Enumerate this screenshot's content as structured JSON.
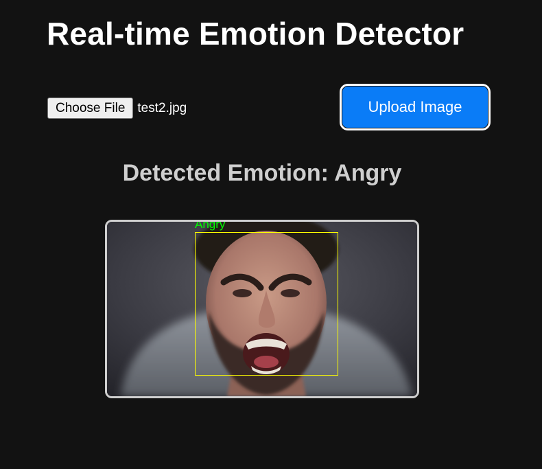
{
  "app": {
    "title": "Real-time Emotion Detector"
  },
  "upload": {
    "choose_file_label": "Choose File",
    "selected_file": "test2.jpg",
    "upload_button_label": "Upload Image"
  },
  "result": {
    "heading": "Detected Emotion: Angry",
    "face_label": "Angry",
    "box_color": "#ffff00",
    "label_color": "#00ff00",
    "image_alt": "Photo of a shouting bearded man with detected face bounding box"
  },
  "colors": {
    "background": "#121212",
    "accent": "#0a7cf7",
    "heading_text": "#cfcfcf"
  }
}
